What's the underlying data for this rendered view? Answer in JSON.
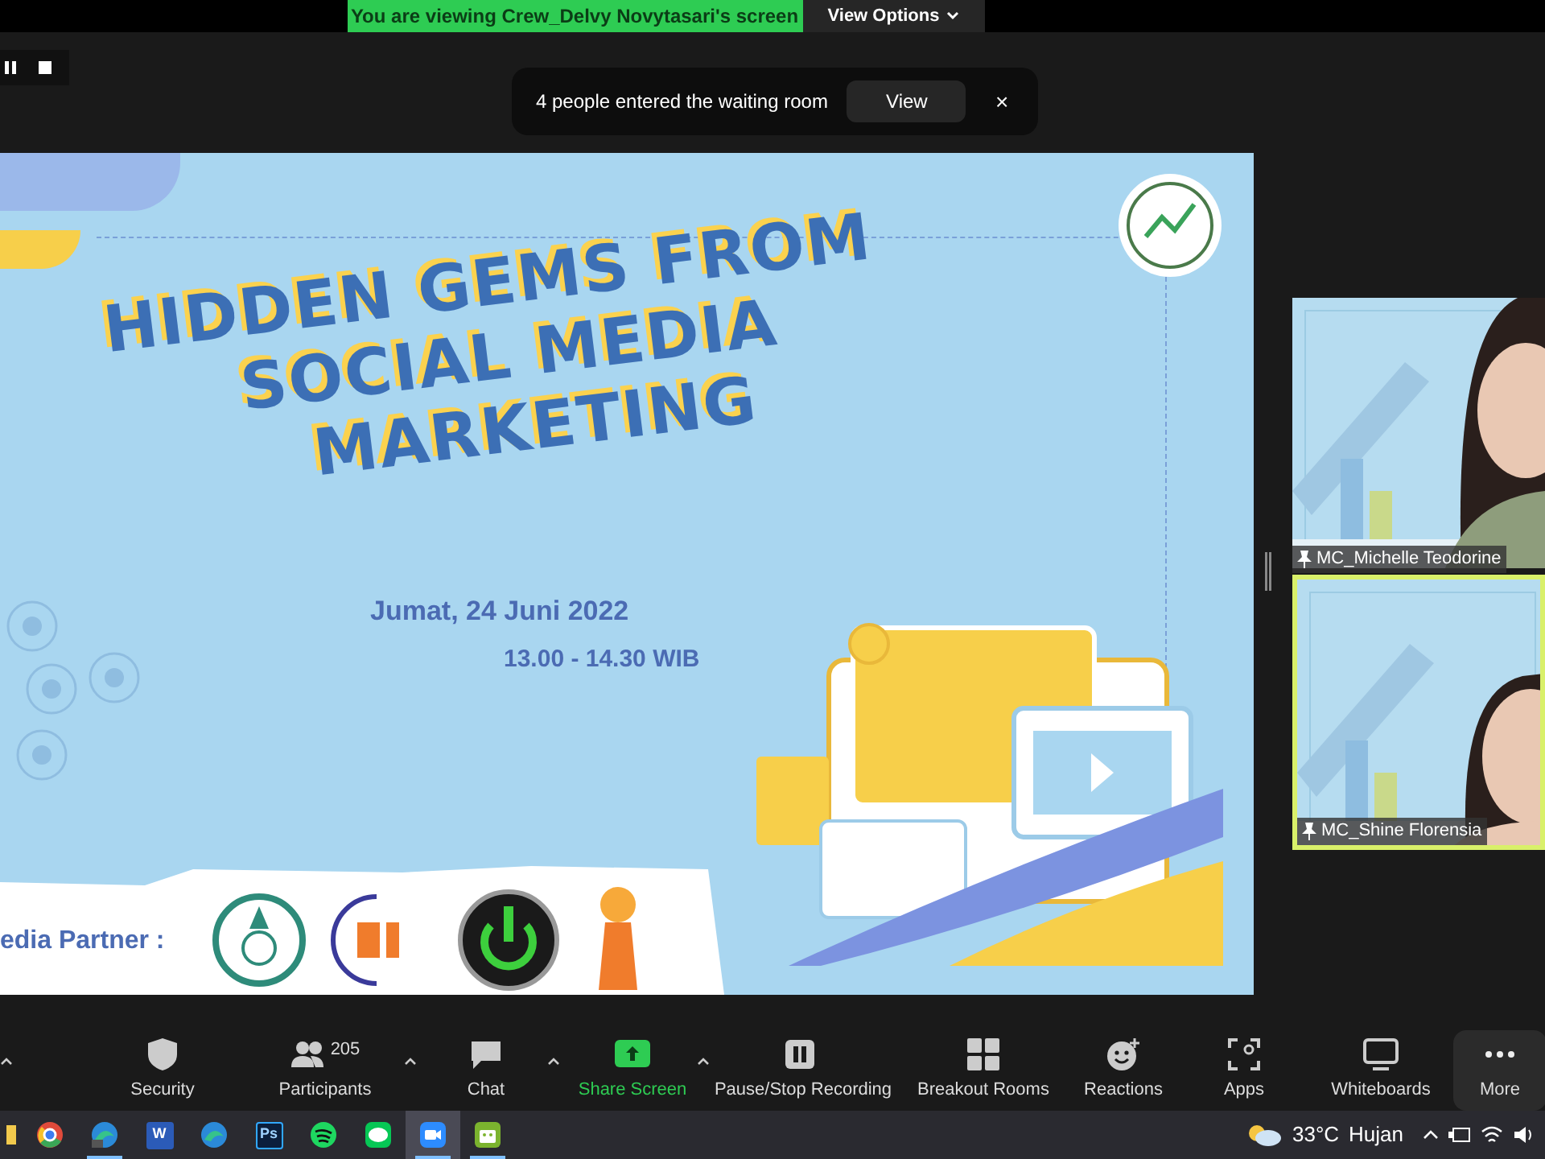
{
  "banner": {
    "text": "You are viewing Crew_Delvy Novytasari's screen",
    "options": "View Options"
  },
  "notification": {
    "text": "4 people entered the waiting room",
    "button": "View",
    "close": "×"
  },
  "slide": {
    "title_lines": [
      "HIDDEN GEMS FROM",
      "SOCIAL MEDIA",
      "MARKETING"
    ],
    "date": "Jumat, 24 Juni 2022",
    "time": "13.00 - 14.30 WIB",
    "partner_label": "edia Partner :"
  },
  "participants": [
    {
      "name": "MC_Michelle Teodorine",
      "active_speaker": false
    },
    {
      "name": "MC_Shine Florensia",
      "active_speaker": true
    }
  ],
  "toolbar": [
    {
      "kind": "security",
      "label": "Security",
      "caret": false,
      "highlighted": false
    },
    {
      "kind": "participants",
      "label": "Participants",
      "count": "205",
      "caret": true,
      "highlighted": false
    },
    {
      "kind": "chat",
      "label": "Chat",
      "caret": true,
      "highlighted": false
    },
    {
      "kind": "share",
      "label": "Share Screen",
      "caret": true,
      "highlighted": true
    },
    {
      "kind": "recording",
      "label": "Pause/Stop Recording",
      "caret": false,
      "highlighted": false
    },
    {
      "kind": "breakout",
      "label": "Breakout Rooms",
      "caret": false,
      "highlighted": false
    },
    {
      "kind": "reactions",
      "label": "Reactions",
      "caret": false,
      "highlighted": false
    },
    {
      "kind": "apps",
      "label": "Apps",
      "caret": false,
      "highlighted": false
    },
    {
      "kind": "whiteboards",
      "label": "Whiteboards",
      "caret": false,
      "highlighted": false
    },
    {
      "kind": "more",
      "label": "More",
      "caret": false,
      "highlighted": false
    }
  ],
  "taskbar": {
    "apps": [
      {
        "kind": "folder",
        "running": false,
        "selected": false
      },
      {
        "kind": "chrome",
        "running": false,
        "selected": false
      },
      {
        "kind": "edge-dev",
        "running": true,
        "selected": false
      },
      {
        "kind": "word",
        "label": "W",
        "running": false,
        "selected": false
      },
      {
        "kind": "edge",
        "running": false,
        "selected": false
      },
      {
        "kind": "photoshop",
        "label": "Ps",
        "running": false,
        "selected": false
      },
      {
        "kind": "spotify",
        "running": false,
        "selected": false
      },
      {
        "kind": "line",
        "running": false,
        "selected": false
      },
      {
        "kind": "zoom",
        "running": true,
        "selected": true
      },
      {
        "kind": "android",
        "running": true,
        "selected": false
      }
    ],
    "temperature": "33°C",
    "weather": "Hujan"
  }
}
